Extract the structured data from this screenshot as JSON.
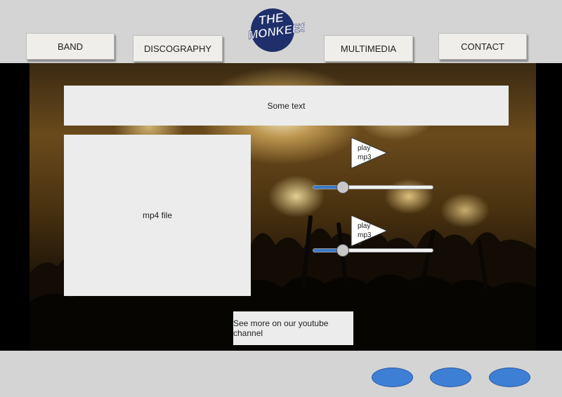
{
  "nav": {
    "band": "BAND",
    "discography": "DISCOGRAPHY",
    "multimedia": "MULTIMEDIA",
    "contact": "CONTACT"
  },
  "logo": {
    "text_line1": "THE",
    "text_line2": "MONKEES"
  },
  "main": {
    "text_box": "Some text",
    "video_label": "mp4 file",
    "youtube_label": "See more on our youtube channel"
  },
  "players": [
    {
      "label_line1": "play",
      "label_line2": "mp3",
      "volume": 0.25
    },
    {
      "label_line1": "play",
      "label_line2": "mp3",
      "volume": 0.25
    }
  ],
  "footer": {
    "button_count": 3
  },
  "colors": {
    "header_bg": "#d4d4d4",
    "button_bg": "#efeeea",
    "panel_bg": "#ececec",
    "accent_blue": "#3e7fd6",
    "slider_fill": "#3a78c9"
  }
}
